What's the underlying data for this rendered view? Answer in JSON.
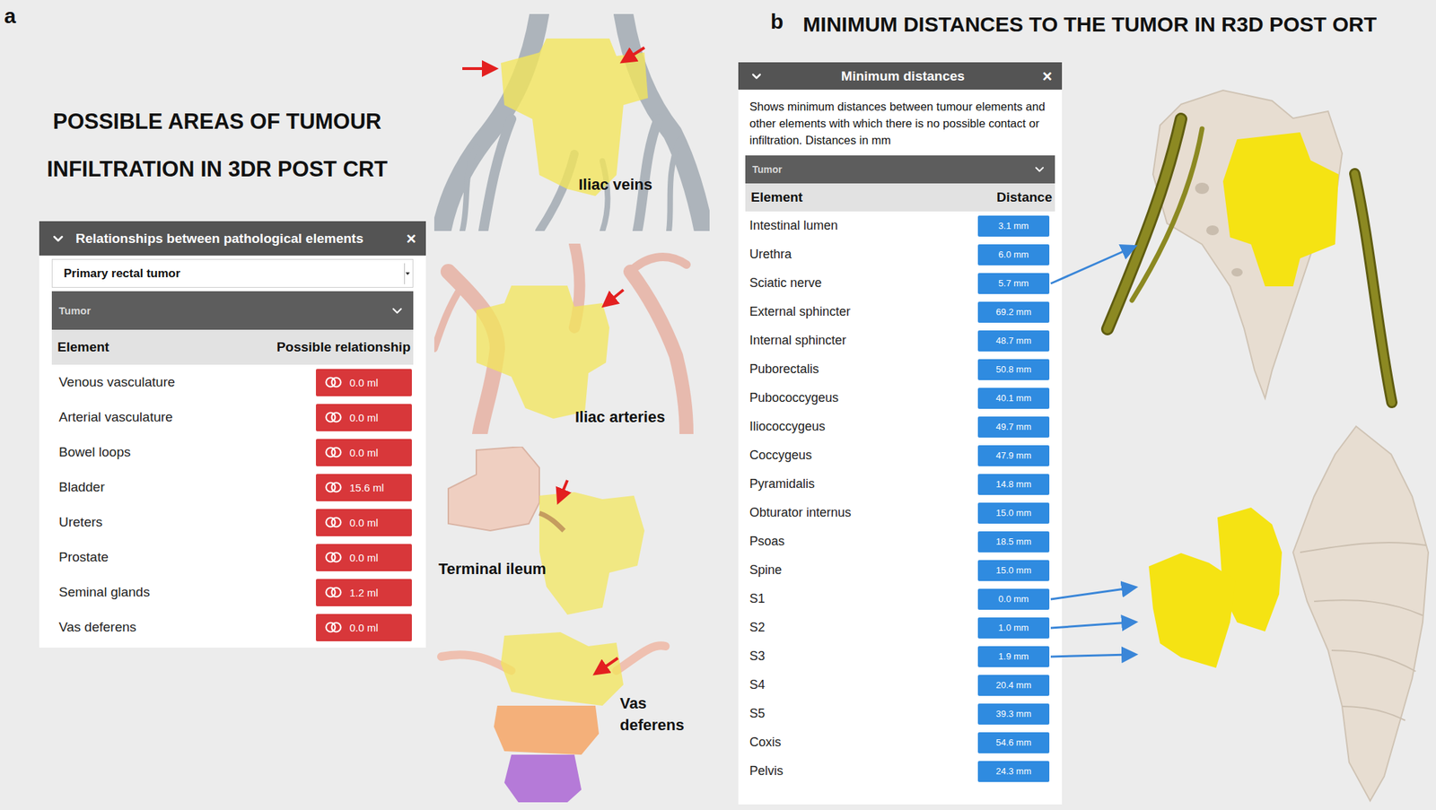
{
  "figure_a": {
    "label": "a",
    "title_lines": [
      "POSSIBLE AREAS OF TUMOUR",
      "INFILTRATION IN 3DR POST CRT"
    ],
    "panel": {
      "title": "Relationships between pathological elements",
      "close": "×",
      "select": "Primary rectal tumor",
      "section": "Tumor",
      "columns": [
        "Element",
        "Possible relationship"
      ],
      "rows": [
        {
          "element": "Venous vasculature",
          "value": "0.0 ml"
        },
        {
          "element": "Arterial vasculature",
          "value": "0.0 ml"
        },
        {
          "element": "Bowel loops",
          "value": "0.0 ml"
        },
        {
          "element": "Bladder",
          "value": "15.6 ml"
        },
        {
          "element": "Ureters",
          "value": "0.0 ml"
        },
        {
          "element": "Prostate",
          "value": "0.0 ml"
        },
        {
          "element": "Seminal glands",
          "value": "1.2 ml"
        },
        {
          "element": "Vas deferens",
          "value": "0.0 ml"
        }
      ]
    },
    "views": [
      {
        "kind": "veins",
        "label_lines": [
          "Iliac veins"
        ]
      },
      {
        "kind": "arteries",
        "label_lines": [
          "Iliac arteries"
        ]
      },
      {
        "kind": "ileum",
        "label_lines": [
          "Terminal ileum"
        ]
      },
      {
        "kind": "vas",
        "label_lines": [
          "Vas",
          "deferens"
        ]
      }
    ]
  },
  "figure_b": {
    "label": "b",
    "title": "MINIMUM DISTANCES TO THE TUMOR IN R3D POST ORT",
    "panel": {
      "title": "Minimum distances",
      "close": "×",
      "description": "Shows minimum distances between tumour elements and other elements with which there is no possible contact or infiltration. Distances in mm",
      "select": "Tumor",
      "columns": [
        "Element",
        "Distance"
      ],
      "rows": [
        {
          "element": "Intestinal lumen",
          "distance": "3.1 mm",
          "arrow": false
        },
        {
          "element": "Urethra",
          "distance": "6.0 mm",
          "arrow": false
        },
        {
          "element": "Sciatic nerve",
          "distance": "5.7 mm",
          "arrow": true
        },
        {
          "element": "External sphincter",
          "distance": "69.2 mm",
          "arrow": false
        },
        {
          "element": "Internal sphincter",
          "distance": "48.7 mm",
          "arrow": false
        },
        {
          "element": "Puborectalis",
          "distance": "50.8 mm",
          "arrow": false
        },
        {
          "element": "Pubococcygeus",
          "distance": "40.1 mm",
          "arrow": false
        },
        {
          "element": "Iliococcygeus",
          "distance": "49.7 mm",
          "arrow": false
        },
        {
          "element": "Coccygeus",
          "distance": "47.9 mm",
          "arrow": false
        },
        {
          "element": "Pyramidalis",
          "distance": "14.8 mm",
          "arrow": false
        },
        {
          "element": "Obturator internus",
          "distance": "15.0 mm",
          "arrow": false
        },
        {
          "element": "Psoas",
          "distance": "18.5 mm",
          "arrow": false
        },
        {
          "element": "Spine",
          "distance": "15.0 mm",
          "arrow": false
        },
        {
          "element": "S1",
          "distance": "0.0 mm",
          "arrow": true
        },
        {
          "element": "S2",
          "distance": "1.0 mm",
          "arrow": true
        },
        {
          "element": "S3",
          "distance": "1.9 mm",
          "arrow": true
        },
        {
          "element": "S4",
          "distance": "20.4 mm",
          "arrow": false
        },
        {
          "element": "S5",
          "distance": "39.3 mm",
          "arrow": false
        },
        {
          "element": "Coxis",
          "distance": "54.6 mm",
          "arrow": false
        },
        {
          "element": "Pelvis",
          "distance": "24.3 mm",
          "arrow": false
        }
      ]
    }
  }
}
